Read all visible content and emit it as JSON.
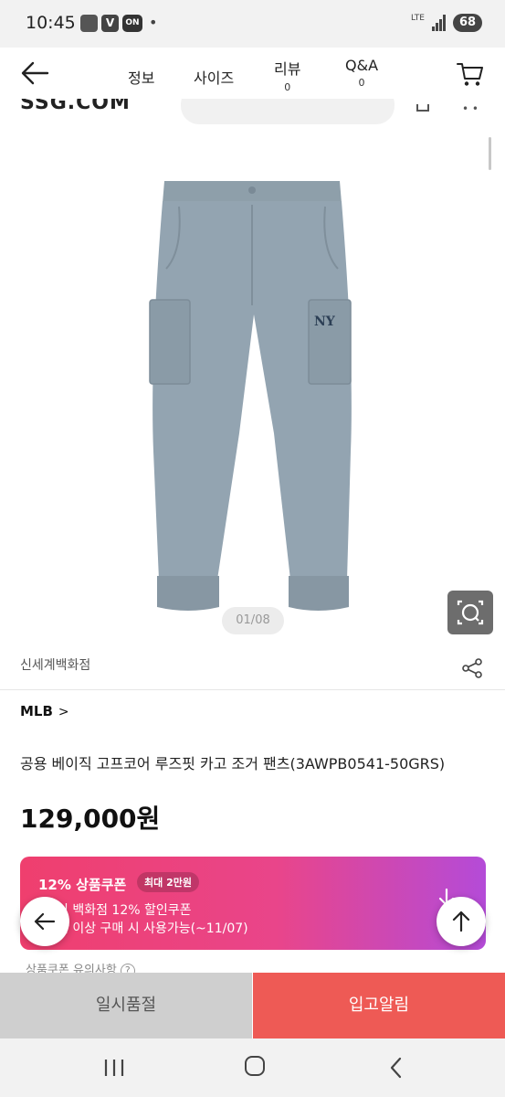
{
  "status_bar": {
    "time": "10:45",
    "network": "LTE",
    "battery": "68"
  },
  "header": {
    "tabs": [
      {
        "label": "정보"
      },
      {
        "label": "사이즈"
      },
      {
        "label": "리뷰",
        "count": "0"
      },
      {
        "label": "Q&A",
        "count": "0"
      }
    ]
  },
  "logo": {
    "text": "SSG.COM"
  },
  "gallery": {
    "counter": "01/08"
  },
  "product": {
    "store": "신세계백화점",
    "brand": "MLB",
    "title": "공용 베이직 고프코어 루즈핏 카고 조거 팬츠(3AWPB0541-50GRS)",
    "price": "129,000원",
    "image_color": "#93a4b1"
  },
  "coupon": {
    "title": "12% 상품쿠폰",
    "max_badge": "최대 2만원",
    "line1": "이 백화점 12% 할인쿠폰",
    "line2": "원 이상 구매 시 사용가능(~11/07)",
    "notice": "상품쿠폰 유의사항",
    "gradient": [
      "#ef3f6e",
      "#b44bd8"
    ]
  },
  "buttons": {
    "soldout": "일시품절",
    "restock_alert": "입고알림"
  },
  "colors": {
    "accent": "#ee5a55",
    "disabled": "#cfcfcf"
  }
}
